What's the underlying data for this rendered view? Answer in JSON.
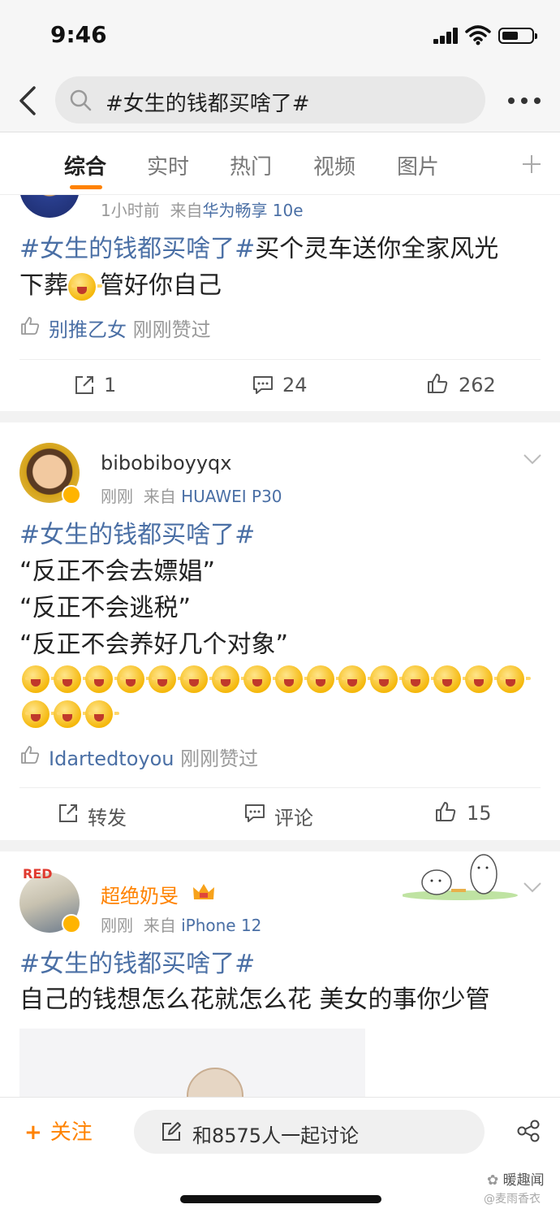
{
  "status_bar": {
    "time": "9:46",
    "battery_level": 0.55
  },
  "search": {
    "query": "#女生的钱都买啥了#"
  },
  "tabs": [
    "综合",
    "实时",
    "热门",
    "视频",
    "图片"
  ],
  "posts": [
    {
      "meta_time": "1小时前",
      "meta_from": "来自",
      "meta_source": "华为畅享 10e",
      "topic": "#女生的钱都买啥了#",
      "text_line1": "买个灵车送你全家风光",
      "text_line2_a": "下葬",
      "text_line2_b": "管好你自己",
      "liker": "别推乙女",
      "liked_suffix": "刚刚赞过",
      "repost": "1",
      "comments": "24",
      "likes": "262"
    },
    {
      "username": "bibobiboyyqx",
      "meta_time": "刚刚",
      "meta_from": "来自",
      "meta_source": "HUAWEI P30",
      "topic": "#女生的钱都买啥了#",
      "line1": "“反正不会去嫖娼”",
      "line2": "“反正不会逃税”",
      "line3": "“反正不会养好几个对象”",
      "emoji_count": 19,
      "liker": "Idartedtoyou",
      "liked_suffix": "刚刚赞过",
      "repost": "转发",
      "comments": "评论",
      "likes": "15"
    },
    {
      "username": "超绝奶旻",
      "meta_time": "刚刚",
      "meta_from": "来自",
      "meta_source": "iPhone 12",
      "topic": "#女生的钱都买啥了#",
      "text": "自己的钱想怎么花就怎么花 美女的事你少管"
    }
  ],
  "bottom": {
    "follow": "关注",
    "discuss": "和8575人一起讨论"
  },
  "watermark": {
    "line1": "暖趣闻",
    "line2": "@麦雨香衣"
  },
  "colors": {
    "accent": "#ff8200",
    "link": "#4a6fa5",
    "badge": "#ffb400"
  },
  "icons": [
    "back-icon",
    "search-icon",
    "more-icon",
    "add-tab-icon",
    "thumb-up-icon",
    "repost-icon",
    "comment-icon",
    "chevron-down-icon",
    "edit-icon",
    "share-icon"
  ]
}
